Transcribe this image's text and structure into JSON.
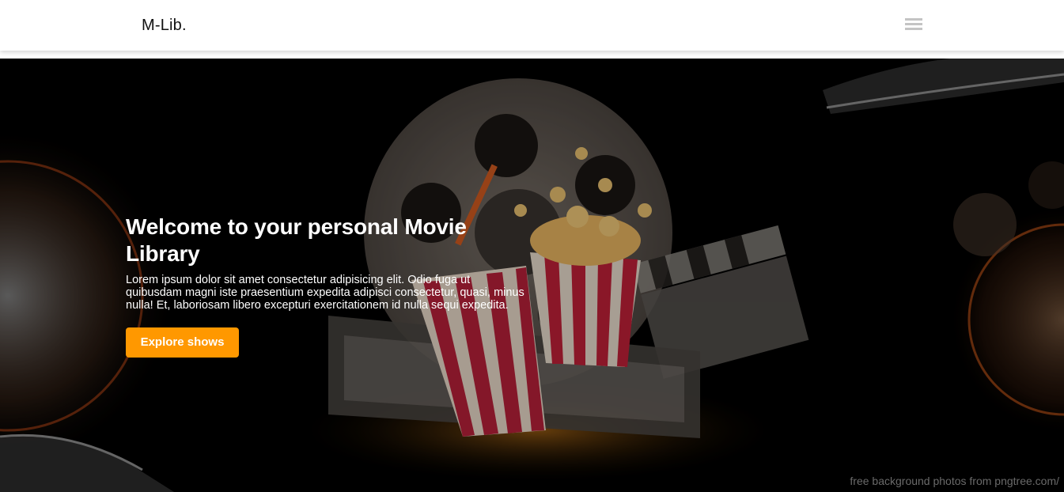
{
  "navbar": {
    "brand": "M-Lib.",
    "menu_icon": "hamburger-menu-icon"
  },
  "hero": {
    "title": "Welcome to your personal Movie Library",
    "description": "Lorem ipsum dolor sit amet consectetur adipisicing elit. Odio fuga ut quibusdam magni iste praesentium expedita adipisci consectetur, quasi, minus nulla! Et, laboriosam libero excepturi exercitationem id nulla sequi expedita.",
    "cta_label": "Explore shows",
    "credit": "free background photos from pngtree.com/"
  },
  "colors": {
    "accent": "#ff9800",
    "navbar_bg": "#ffffff",
    "hero_bg": "#000000",
    "menu_icon": "#c4c4c4"
  }
}
